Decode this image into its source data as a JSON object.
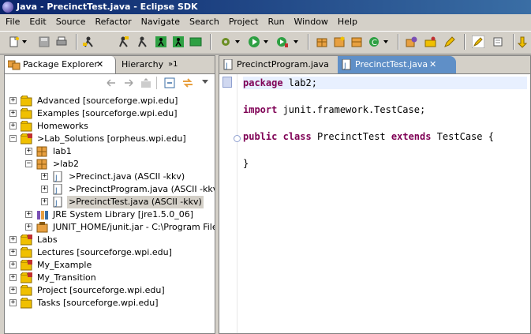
{
  "window": {
    "title": "Java - PrecinctTest.java - Eclipse SDK"
  },
  "menu": [
    "File",
    "Edit",
    "Source",
    "Refactor",
    "Navigate",
    "Search",
    "Project",
    "Run",
    "Window",
    "Help"
  ],
  "package_view": {
    "tab_label": "Package Explorer",
    "tab_close": "✕",
    "tab2_label": "Hierarchy",
    "overflow_label": "»1"
  },
  "tree": {
    "advanced": "Advanced  [sourceforge.wpi.edu]",
    "examples": "Examples  [sourceforge.wpi.edu]",
    "homeworks": "Homeworks",
    "lab_solutions": ">Lab_Solutions  [orpheus.wpi.edu]",
    "lab1": "lab1",
    "lab2": ">lab2",
    "precinct": ">Precinct.java   (ASCII -kkv)",
    "precinct_program": ">PrecinctProgram.java   (ASCII -kkv)",
    "precinct_test": ">PrecinctTest.java   (ASCII -kkv)",
    "jre": "JRE System Library [jre1.5.0_06]",
    "junit": "JUNIT_HOME/junit.jar - C:\\Program Files\\e",
    "labs": "Labs",
    "lectures": "Lectures  [sourceforge.wpi.edu]",
    "my_example": "My_Example",
    "my_transition": "My_Transition",
    "project": "Project  [sourceforge.wpi.edu]",
    "tasks": "Tasks  [sourceforge.wpi.edu]"
  },
  "editor": {
    "tab1": "PrecinctProgram.java",
    "tab2": "PrecinctTest.java",
    "tab_close": "✕",
    "code": {
      "l1_kw": "package",
      "l1_rest": " lab2;",
      "l2_kw": "import",
      "l2_rest": " junit.framework.TestCase;",
      "l3_kw1": "public",
      "l3_kw2": "class",
      "l3_name": "PrecinctTest",
      "l3_kw3": "extends",
      "l3_super": "TestCase {",
      "l4": "}"
    }
  },
  "colors": {
    "title_bar": "#0a246a",
    "active_editor_tab": "#5f8fc7",
    "keyword": "#7f0055"
  }
}
